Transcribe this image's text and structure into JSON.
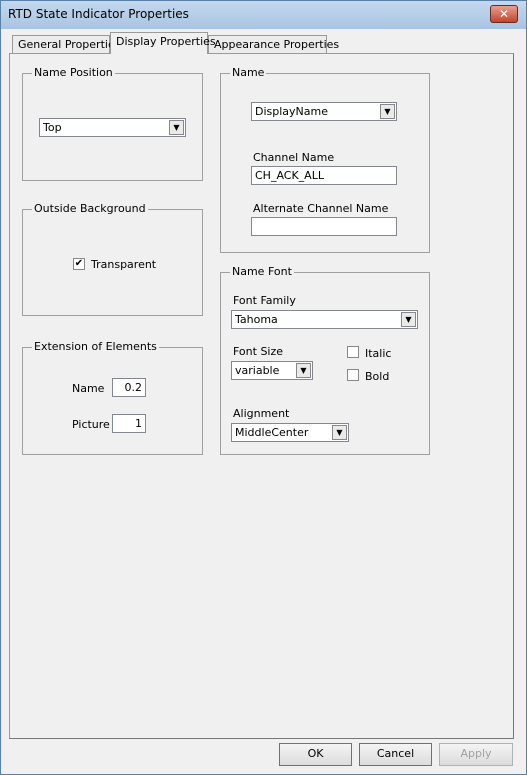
{
  "window": {
    "title": "RTD State Indicator Properties",
    "close_glyph": "✕"
  },
  "tabs": [
    {
      "label": "General Properties"
    },
    {
      "label": "Display Properties",
      "selected": true
    },
    {
      "label": "Appearance Properties"
    }
  ],
  "name_position": {
    "title": "Name Position",
    "value": "Top"
  },
  "outside_background": {
    "title": "Outside Background",
    "transparent_label": "Transparent",
    "transparent_checked": true
  },
  "extension": {
    "title": "Extension of Elements",
    "name_label": "Name",
    "name_value": "0.2",
    "picture_label": "Picture",
    "picture_value": "1"
  },
  "name": {
    "title": "Name",
    "source_value": "DisplayName",
    "channel_label": "Channel Name",
    "channel_value": "CH_ACK_ALL",
    "alt_label": "Alternate Channel  Name",
    "alt_value": ""
  },
  "name_font": {
    "title": "Name Font",
    "family_label": "Font Family",
    "family_value": "Tahoma",
    "size_label": "Font Size",
    "size_value": "variable",
    "italic_label": "Italic",
    "italic_checked": false,
    "bold_label": "Bold",
    "bold_checked": false,
    "alignment_label": "Alignment",
    "alignment_value": "MiddleCenter"
  },
  "buttons": {
    "ok": "OK",
    "cancel": "Cancel",
    "apply": "Apply"
  },
  "icons": {
    "dropdown": "▼",
    "check": "✔"
  }
}
